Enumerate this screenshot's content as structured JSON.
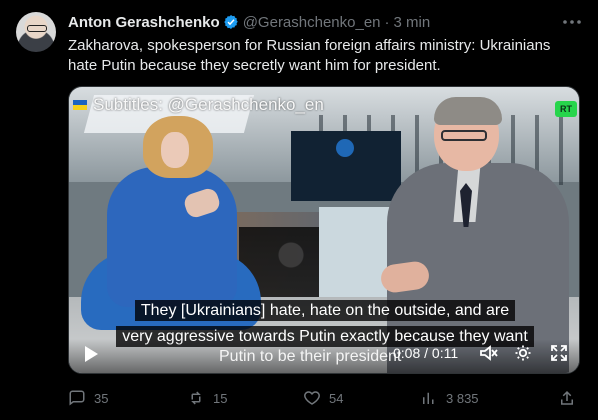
{
  "tweet": {
    "author_name": "Anton Gerashchenko",
    "handle": "@Gerashchenko_en",
    "separator": "·",
    "time": "3 min",
    "text": "Zakharova, spokesperson for Russian foreign affairs ministry: Ukrainians hate Putin because they secretly want him for president."
  },
  "video": {
    "watermark": "Subtitles: @Gerashchenko_en",
    "channel_logo": "RT",
    "subtitle_line1": "They [Ukrainians] hate, hate on the outside, and are",
    "subtitle_line2": "very aggressive towards Putin exactly because they want",
    "subtitle_line3": "Putin to be their president",
    "time": "0:08 / 0:11",
    "icons": [
      "play-icon",
      "mute-icon",
      "settings-icon",
      "fullscreen-icon"
    ]
  },
  "actions": {
    "reply_count": "35",
    "retweet_count": "15",
    "like_count": "54",
    "view_count": "3 835",
    "icons": [
      "reply-icon",
      "retweet-icon",
      "like-icon",
      "views-icon",
      "share-icon"
    ]
  },
  "colors": {
    "background": "#000000",
    "text": "#e7e9ea",
    "muted": "#71767b",
    "verified": "#1d9bf0",
    "rt_green": "#27d54c"
  }
}
